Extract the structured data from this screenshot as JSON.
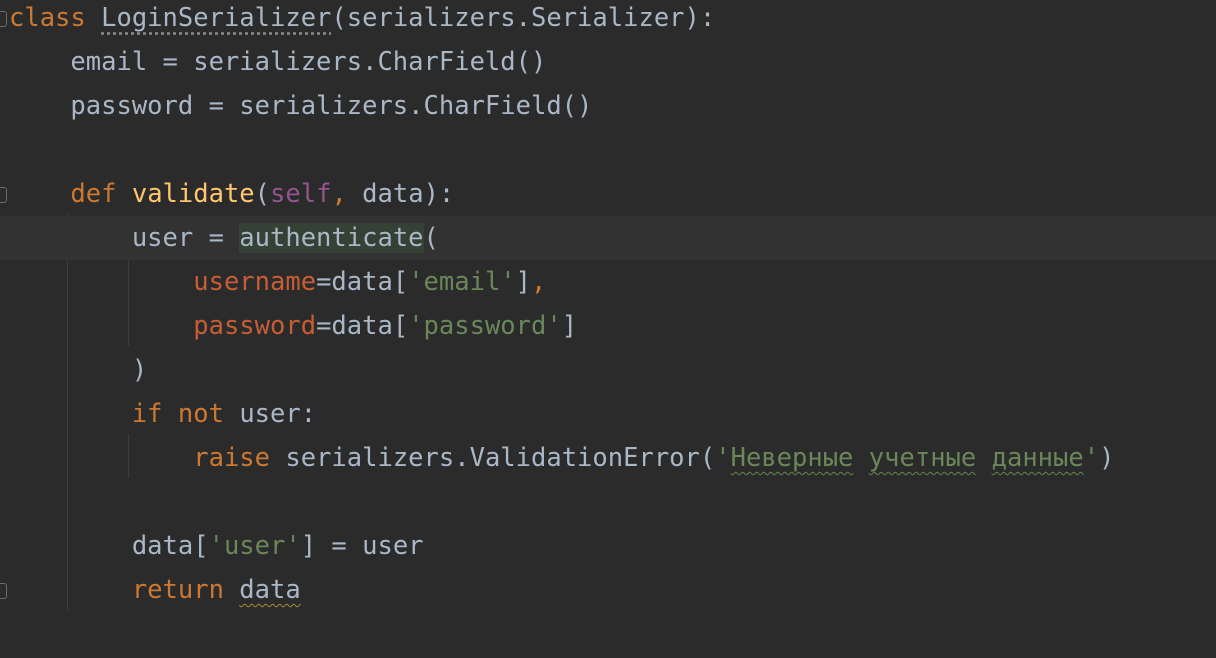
{
  "editor": {
    "lines": [
      {
        "tokens": [
          {
            "t": "class ",
            "c": "kw"
          },
          {
            "t": "LoginSerializer",
            "c": "plain dotted"
          },
          {
            "t": "(serializers.Serializer):",
            "c": "plain"
          }
        ]
      },
      {
        "tokens": [
          {
            "t": "    email = serializers.CharField()",
            "c": "plain"
          }
        ]
      },
      {
        "tokens": [
          {
            "t": "    password = serializers.CharField()",
            "c": "plain"
          }
        ]
      },
      {
        "tokens": []
      },
      {
        "tokens": [
          {
            "t": "    ",
            "c": "plain"
          },
          {
            "t": "def ",
            "c": "kw"
          },
          {
            "t": "validate",
            "c": "fn"
          },
          {
            "t": "(",
            "c": "plain"
          },
          {
            "t": "self",
            "c": "self"
          },
          {
            "t": ", ",
            "c": "kw"
          },
          {
            "t": "data):",
            "c": "plain"
          }
        ]
      },
      {
        "tokens": [
          {
            "t": "        user = ",
            "c": "plain"
          },
          {
            "t": "authenticate",
            "c": "plain hl"
          },
          {
            "t": "(",
            "c": "plain"
          }
        ]
      },
      {
        "tokens": [
          {
            "t": "            ",
            "c": "plain"
          },
          {
            "t": "username",
            "c": "param"
          },
          {
            "t": "=data[",
            "c": "plain"
          },
          {
            "t": "'email'",
            "c": "str"
          },
          {
            "t": "]",
            "c": "plain"
          },
          {
            "t": ",",
            "c": "kw"
          }
        ]
      },
      {
        "tokens": [
          {
            "t": "            ",
            "c": "plain"
          },
          {
            "t": "password",
            "c": "param"
          },
          {
            "t": "=data[",
            "c": "plain"
          },
          {
            "t": "'password'",
            "c": "str"
          },
          {
            "t": "]",
            "c": "plain"
          }
        ]
      },
      {
        "tokens": [
          {
            "t": "        )",
            "c": "plain"
          }
        ]
      },
      {
        "tokens": [
          {
            "t": "        ",
            "c": "plain"
          },
          {
            "t": "if ",
            "c": "kw"
          },
          {
            "t": "not ",
            "c": "kw"
          },
          {
            "t": "user:",
            "c": "plain"
          }
        ]
      },
      {
        "tokens": [
          {
            "t": "            ",
            "c": "plain"
          },
          {
            "t": "raise ",
            "c": "kw"
          },
          {
            "t": "serializers.ValidationError(",
            "c": "plain"
          },
          {
            "t": "'",
            "c": "str"
          },
          {
            "t": "Неверные",
            "c": "str wavy-green"
          },
          {
            "t": " ",
            "c": "str"
          },
          {
            "t": "учетные",
            "c": "str wavy-green"
          },
          {
            "t": " ",
            "c": "str"
          },
          {
            "t": "данные",
            "c": "str wavy-green"
          },
          {
            "t": "'",
            "c": "str"
          },
          {
            "t": ")",
            "c": "plain"
          }
        ]
      },
      {
        "tokens": []
      },
      {
        "tokens": [
          {
            "t": "        data[",
            "c": "plain"
          },
          {
            "t": "'user'",
            "c": "str"
          },
          {
            "t": "] = user",
            "c": "plain"
          }
        ]
      },
      {
        "tokens": [
          {
            "t": "        ",
            "c": "plain"
          },
          {
            "t": "return ",
            "c": "kw"
          },
          {
            "t": "data",
            "c": "plain wavy-yellow"
          }
        ]
      }
    ],
    "current_line_index": 5,
    "colors": {
      "background": "#2b2b2b",
      "current_line": "#323232",
      "keyword": "#cc7832",
      "function": "#ffc66d",
      "self": "#94558d",
      "string": "#6a8759",
      "param": "#c75d34",
      "default": "#a9b7c6"
    },
    "icons": [
      "fold-marker-icon"
    ]
  }
}
